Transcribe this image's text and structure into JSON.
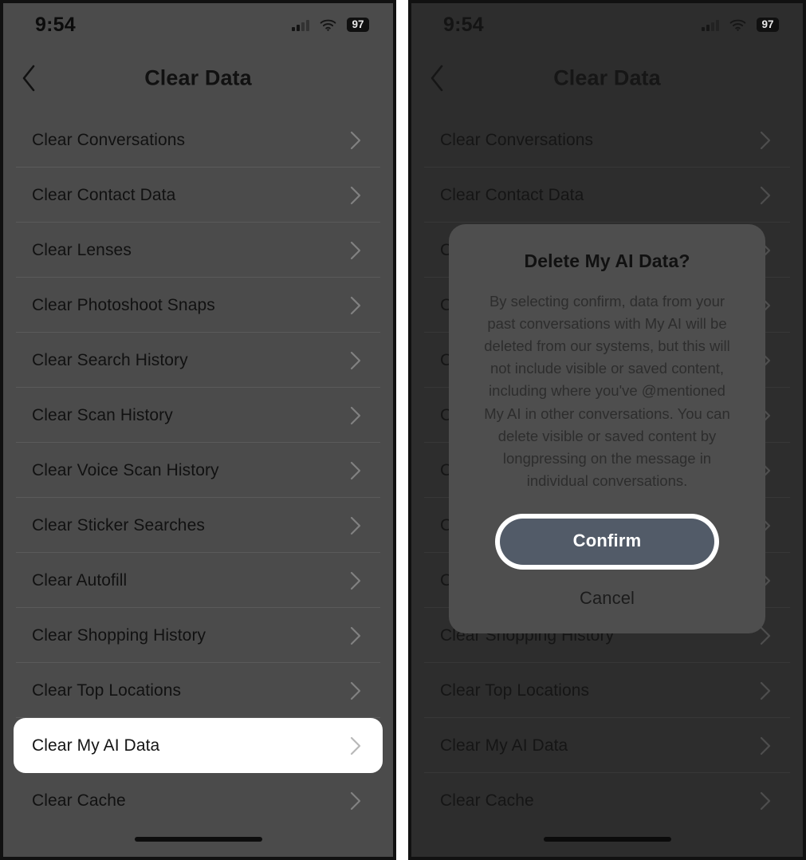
{
  "status_bar": {
    "time": "9:54",
    "battery_level": "97",
    "signal_icon": "cellular-signal-icon",
    "wifi_icon": "wifi-icon",
    "battery_icon": "battery-icon"
  },
  "nav": {
    "title": "Clear Data",
    "back_icon": "chevron-left-icon"
  },
  "list": {
    "chevron_icon": "chevron-right-icon",
    "items": [
      {
        "label": "Clear Conversations",
        "highlighted": false
      },
      {
        "label": "Clear Contact Data",
        "highlighted": false
      },
      {
        "label": "Clear Lenses",
        "highlighted": false
      },
      {
        "label": "Clear Photoshoot Snaps",
        "highlighted": false
      },
      {
        "label": "Clear Search History",
        "highlighted": false
      },
      {
        "label": "Clear Scan History",
        "highlighted": false
      },
      {
        "label": "Clear Voice Scan History",
        "highlighted": false
      },
      {
        "label": "Clear Sticker Searches",
        "highlighted": false
      },
      {
        "label": "Clear Autofill",
        "highlighted": false
      },
      {
        "label": "Clear Shopping History",
        "highlighted": false
      },
      {
        "label": "Clear Top Locations",
        "highlighted": false
      },
      {
        "label": "Clear My AI Data",
        "highlighted": true
      },
      {
        "label": "Clear Cache",
        "highlighted": false
      }
    ]
  },
  "dialog": {
    "title": "Delete My AI Data?",
    "body": "By selecting confirm, data from your past conversations with My AI will be deleted from our systems, but this will not include visible or saved content, including where you've @mentioned My AI in other conversations. You can delete visible or saved content by longpressing on the message in individual conversations.",
    "confirm_label": "Confirm",
    "cancel_label": "Cancel"
  },
  "colors": {
    "panel_background": "#4b4b4b",
    "panel_background_dimmed": "#2d2d2d",
    "modal_background": "#4e4e4e",
    "confirm_button": "#525b68",
    "highlight_row": "#ffffff",
    "text_primary": "#111111"
  }
}
